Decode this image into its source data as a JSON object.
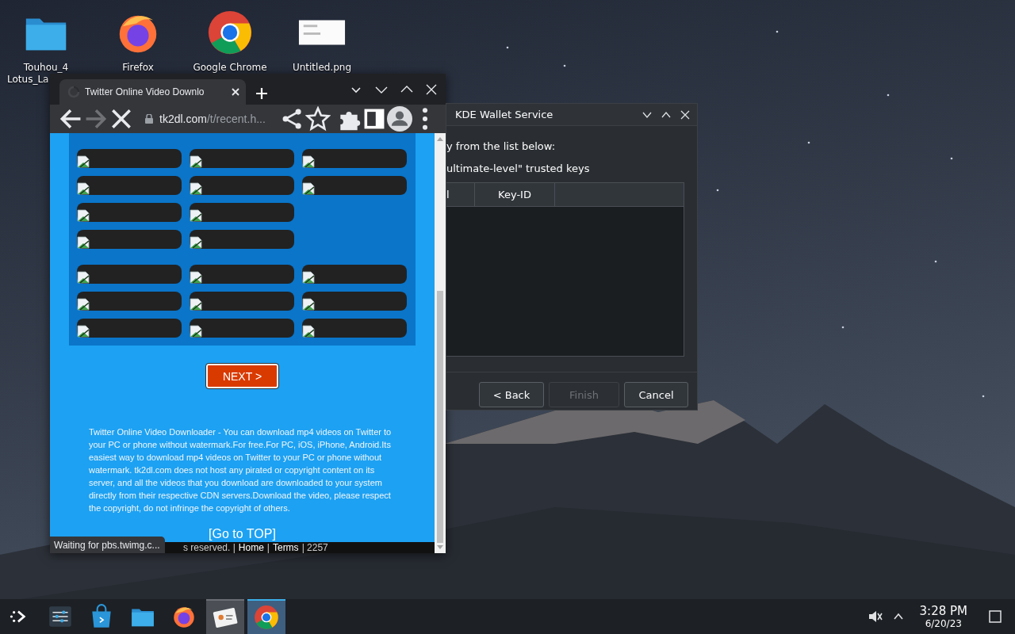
{
  "desktop_icons": [
    {
      "kind": "folder",
      "label_lines": [
        "Touhou_4",
        "Lotus_La"
      ]
    },
    {
      "kind": "firefox",
      "label_lines": [
        "Firefox"
      ]
    },
    {
      "kind": "chrome",
      "label_lines": [
        "Google Chrome"
      ]
    },
    {
      "kind": "picture",
      "label_lines": [
        "Untitled.png"
      ]
    }
  ],
  "browser": {
    "tab": {
      "title": "Twitter Online Video Downlo",
      "loading": true
    },
    "toolbar": {
      "forward_disabled": true,
      "loading": true
    },
    "address": {
      "host": "tk2dl.com",
      "path": "/t/recent.h..."
    },
    "page": {
      "link_groups": [
        {
          "rows": [
            {
              "links": [
                {
                  "kind": "broken-image"
                },
                {
                  "kind": "broken-image"
                },
                {
                  "kind": "broken-image"
                }
              ]
            },
            {
              "links": [
                {
                  "kind": "broken-image"
                },
                {
                  "kind": "broken-image"
                },
                {
                  "kind": "broken-image"
                }
              ]
            },
            {
              "links": [
                {
                  "kind": "broken-image"
                },
                {
                  "kind": "broken-image"
                }
              ]
            },
            {
              "links": [
                {
                  "kind": "broken-image"
                },
                {
                  "kind": "broken-image"
                }
              ]
            }
          ]
        },
        {
          "rows": [
            {
              "links": [
                {
                  "kind": "broken-image"
                },
                {
                  "kind": "broken-image"
                },
                {
                  "kind": "broken-image"
                }
              ]
            },
            {
              "links": [
                {
                  "kind": "broken-image"
                },
                {
                  "kind": "broken-image"
                },
                {
                  "kind": "broken-image"
                }
              ]
            },
            {
              "links": [
                {
                  "kind": "broken-image"
                },
                {
                  "kind": "broken-image"
                },
                {
                  "kind": "broken-image"
                }
              ]
            }
          ]
        }
      ],
      "next_button": "NEXT >",
      "description": "Twitter Online Video Downloader - You can download mp4 videos on Twitter to your PC or phone without watermark.For free.For PC, iOS, iPhone, Android.Its easiest way to download mp4 videos on Twitter to your PC or phone without watermark. tk2dl.com does not host any pirated or copyright content on its server, and all the videos that you download are downloaded to your system directly from their respective CDN servers.Download the video, please respect the copyright, do not infringe the copyright of others.",
      "top_link": "[Go to TOP]",
      "footer": [
        {
          "kind": "text",
          "text": "s reserved. |"
        },
        {
          "kind": "link",
          "text": "Home"
        },
        {
          "kind": "text",
          "text": "|"
        },
        {
          "kind": "link",
          "text": "Terms"
        },
        {
          "kind": "text",
          "text": "| 2257"
        }
      ]
    },
    "status_bubble": "Waiting for pbs.twimg.c..."
  },
  "wallet": {
    "title": "KDE Wallet Service",
    "lines": [
      "y from the list below:",
      "ultimate-level\" trusted keys"
    ],
    "columns": [
      "l",
      "Key-ID"
    ],
    "buttons": [
      {
        "label": "< Back",
        "disabled": false
      },
      {
        "label": "Finish",
        "disabled": true
      },
      {
        "label": "Cancel",
        "disabled": false
      }
    ]
  },
  "taskbar": {
    "items": [
      {
        "kind": "launcher",
        "open": false,
        "focused": false
      },
      {
        "kind": "settings",
        "open": false,
        "focused": false
      },
      {
        "kind": "store",
        "open": false,
        "focused": false
      },
      {
        "kind": "folder",
        "open": false,
        "focused": false
      },
      {
        "kind": "firefox",
        "open": false,
        "focused": false
      },
      {
        "kind": "card",
        "open": true,
        "focused": false
      },
      {
        "kind": "chrome",
        "open": true,
        "focused": true
      }
    ],
    "muted": true,
    "time": "3:28 PM",
    "date": "6/20/23"
  }
}
